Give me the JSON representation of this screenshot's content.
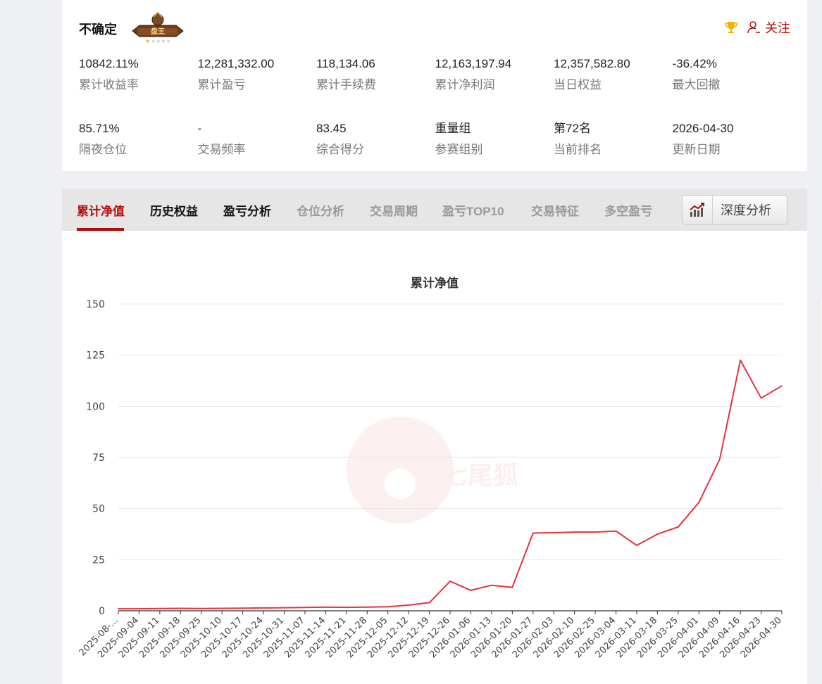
{
  "profile": {
    "name": "不确定",
    "badge_text": "盘王",
    "follow_label": "关注"
  },
  "stats_row1": [
    {
      "value": "10842.11%",
      "label": "累计收益率"
    },
    {
      "value": "12,281,332.00",
      "label": "累计盈亏"
    },
    {
      "value": "118,134.06",
      "label": "累计手续费"
    },
    {
      "value": "12,163,197.94",
      "label": "累计净利润"
    },
    {
      "value": "12,357,582.80",
      "label": "当日权益"
    },
    {
      "value": "-36.42%",
      "label": "最大回撤"
    }
  ],
  "stats_row2": [
    {
      "value": "85.71%",
      "label": "隔夜仓位"
    },
    {
      "value": "-",
      "label": "交易频率"
    },
    {
      "value": "83.45",
      "label": "综合得分"
    },
    {
      "value": "重量组",
      "label": "参赛组别"
    },
    {
      "value": "第72名",
      "label": "当前排名"
    },
    {
      "value": "2026-04-30",
      "label": "更新日期"
    }
  ],
  "tabs": [
    "累计净值",
    "历史权益",
    "盈亏分析",
    "仓位分析",
    "交易周期",
    "盈亏TOP10",
    "交易特征",
    "多空盈亏"
  ],
  "deep_analysis_label": "深度分析",
  "colors": {
    "accent": "#b30d0d",
    "line": "#e2333b"
  },
  "chart_data": {
    "type": "line",
    "title": "累计净值",
    "xlabel": "",
    "ylabel": "",
    "ylim": [
      0,
      150
    ],
    "y_ticks": [
      0,
      25,
      50,
      75,
      100,
      125,
      150
    ],
    "grid": true,
    "x_tick_labels": [
      "2025-08-...",
      "2025-09-04",
      "2025-09-11",
      "2025-09-18",
      "2025-09-25",
      "2025-10-10",
      "2025-10-17",
      "2025-10-24",
      "2025-10-31",
      "2025-11-07",
      "2025-11-14",
      "2025-11-21",
      "2025-11-28",
      "2025-12-05",
      "2025-12-12",
      "2025-12-19",
      "2025-12-26",
      "2026-01-06",
      "2026-01-13",
      "2026-01-20",
      "2026-01-27",
      "2026-02-03",
      "2026-02-10",
      "2026-02-25",
      "2026-03-04",
      "2026-03-11",
      "2026-03-18",
      "2026-03-25",
      "2026-04-01",
      "2026-04-09",
      "2026-04-16",
      "2026-04-23",
      "2026-04-30"
    ],
    "series": [
      {
        "color": "#e2333b",
        "values": [
          {
            "x": "2025-08-...",
            "y": 1.0
          },
          {
            "x": "2025-09-04",
            "y": 1.0
          },
          {
            "x": "2025-09-11",
            "y": 1.1
          },
          {
            "x": "2025-09-18",
            "y": 1.2
          },
          {
            "x": "2025-09-25",
            "y": 1.1
          },
          {
            "x": "2025-10-10",
            "y": 1.2
          },
          {
            "x": "2025-10-17",
            "y": 1.3
          },
          {
            "x": "2025-10-24",
            "y": 1.4
          },
          {
            "x": "2025-10-31",
            "y": 1.5
          },
          {
            "x": "2025-11-07",
            "y": 1.6
          },
          {
            "x": "2025-11-14",
            "y": 1.8
          },
          {
            "x": "2025-11-21",
            "y": 1.7
          },
          {
            "x": "2025-11-28",
            "y": 1.8
          },
          {
            "x": "2025-12-05",
            "y": 2.0
          },
          {
            "x": "2025-12-12",
            "y": 2.8
          },
          {
            "x": "2025-12-19",
            "y": 4.0
          },
          {
            "x": "2025-12-26",
            "y": 14.5
          },
          {
            "x": "2026-01-06",
            "y": 10.0
          },
          {
            "x": "2026-01-13",
            "y": 12.5
          },
          {
            "x": "2026-01-20",
            "y": 11.5
          },
          {
            "x": "2026-01-27",
            "y": 38.0
          },
          {
            "x": "2026-02-03",
            "y": 38.2
          },
          {
            "x": "2026-02-10",
            "y": 38.5
          },
          {
            "x": "2026-02-25",
            "y": 38.5
          },
          {
            "x": "2026-03-04",
            "y": 39.0
          },
          {
            "x": "2026-03-11",
            "y": 32.0
          },
          {
            "x": "2026-03-18",
            "y": 37.5
          },
          {
            "x": "2026-03-25",
            "y": 41.0
          },
          {
            "x": "2026-04-01",
            "y": 53.0
          },
          {
            "x": "2026-04-09",
            "y": 74.0
          },
          {
            "x": "2026-04-16",
            "y": 122.5
          },
          {
            "x": "2026-04-23",
            "y": 104.0
          },
          {
            "x": "2026-04-30",
            "y": 110.0
          }
        ]
      }
    ]
  }
}
